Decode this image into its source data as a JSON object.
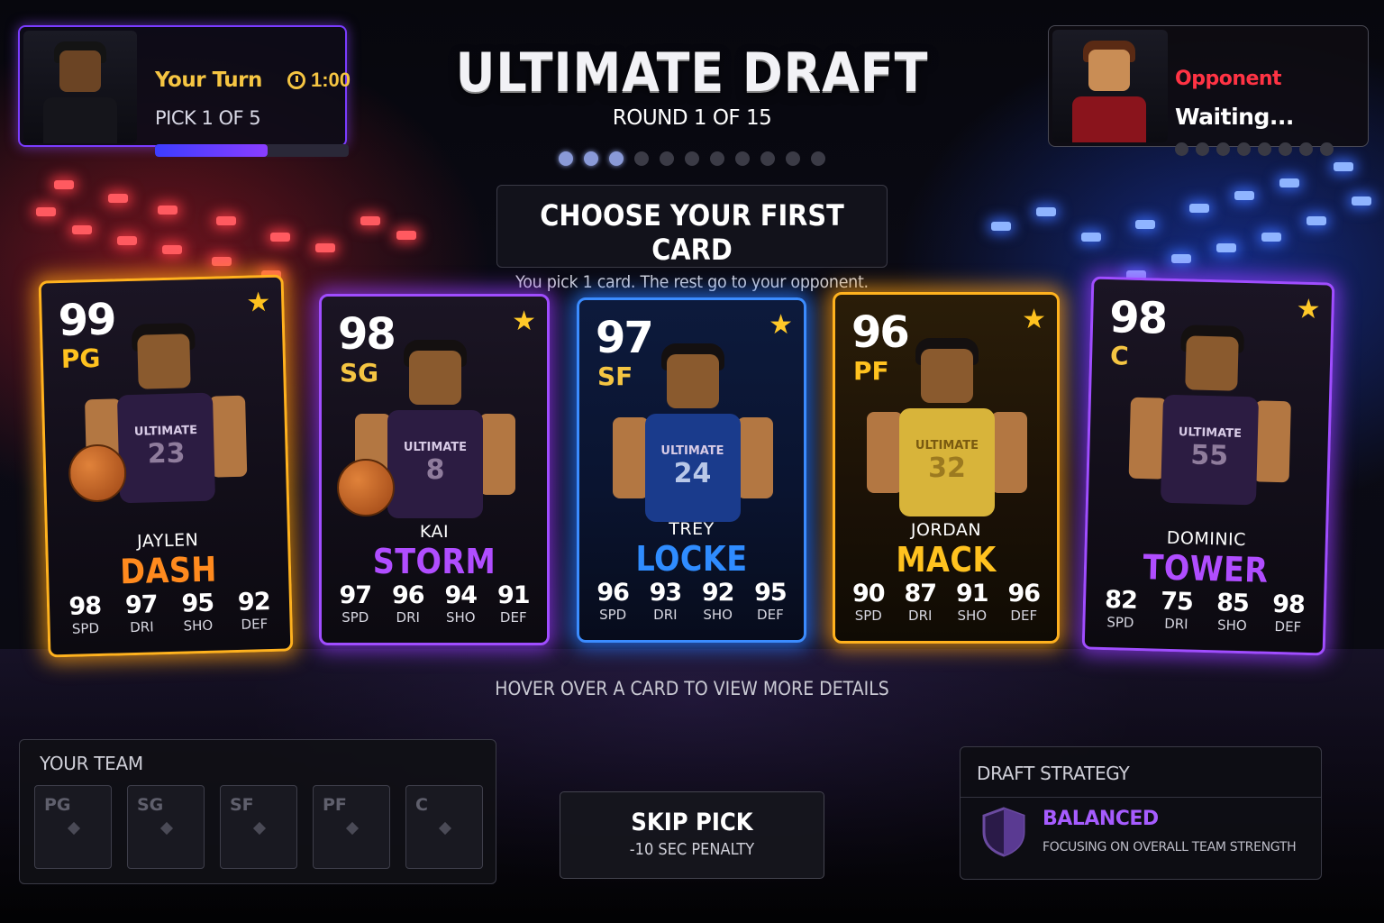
{
  "header": {
    "title": "ULTIMATE DRAFT",
    "round": "ROUND 1 OF 15",
    "round_dots_total": 11,
    "round_dots_active": 3
  },
  "player": {
    "status": "Your Turn",
    "timer": "1:00",
    "pick": "PICK 1 OF 5",
    "progress_percent": 58
  },
  "opponent": {
    "label": "Opponent",
    "status": "Waiting...",
    "dots": 8
  },
  "prompt": {
    "title": "CHOOSE YOUR FIRST CARD",
    "subtitle": "You pick 1 card. The rest go to your opponent."
  },
  "cards": [
    {
      "rating": "99",
      "position": "PG",
      "first_name": "JAYLEN",
      "last_name": "DASH",
      "jersey_team": "ULTIMATE",
      "jersey_number": "23",
      "theme": "gold",
      "name_color": "orange",
      "stats": [
        {
          "value": "98",
          "label": "SPD"
        },
        {
          "value": "97",
          "label": "DRI"
        },
        {
          "value": "95",
          "label": "SHO"
        },
        {
          "value": "92",
          "label": "DEF"
        }
      ]
    },
    {
      "rating": "98",
      "position": "SG",
      "first_name": "KAI",
      "last_name": "STORM",
      "jersey_team": "ULTIMATE",
      "jersey_number": "8",
      "theme": "purple",
      "name_color": "violet",
      "stats": [
        {
          "value": "97",
          "label": "SPD"
        },
        {
          "value": "96",
          "label": "DRI"
        },
        {
          "value": "94",
          "label": "SHO"
        },
        {
          "value": "91",
          "label": "DEF"
        }
      ]
    },
    {
      "rating": "97",
      "position": "SF",
      "first_name": "TREY",
      "last_name": "LOCKE",
      "jersey_team": "ULTIMATE",
      "jersey_number": "24",
      "theme": "blue",
      "name_color": "blue",
      "stats": [
        {
          "value": "96",
          "label": "SPD"
        },
        {
          "value": "93",
          "label": "DRI"
        },
        {
          "value": "92",
          "label": "SHO"
        },
        {
          "value": "95",
          "label": "DEF"
        }
      ]
    },
    {
      "rating": "96",
      "position": "PF",
      "first_name": "JORDAN",
      "last_name": "MACK",
      "jersey_team": "ULTIMATE",
      "jersey_number": "32",
      "theme": "gold",
      "name_color": "yellow",
      "stats": [
        {
          "value": "90",
          "label": "SPD"
        },
        {
          "value": "87",
          "label": "DRI"
        },
        {
          "value": "91",
          "label": "SHO"
        },
        {
          "value": "96",
          "label": "DEF"
        }
      ]
    },
    {
      "rating": "98",
      "position": "C",
      "first_name": "DOMINIC",
      "last_name": "TOWER",
      "jersey_team": "ULTIMATE",
      "jersey_number": "55",
      "theme": "purple",
      "name_color": "violet",
      "stats": [
        {
          "value": "82",
          "label": "SPD"
        },
        {
          "value": "75",
          "label": "DRI"
        },
        {
          "value": "85",
          "label": "SHO"
        },
        {
          "value": "98",
          "label": "DEF"
        }
      ]
    }
  ],
  "hint": "HOVER OVER A CARD TO VIEW MORE DETAILS",
  "team": {
    "title": "YOUR TEAM",
    "slots": [
      "PG",
      "SG",
      "SF",
      "PF",
      "C"
    ]
  },
  "skip": {
    "label": "SKIP PICK",
    "penalty": "-10 SEC PENALTY"
  },
  "strategy": {
    "title": "DRAFT STRATEGY",
    "name": "BALANCED",
    "description": "FOCUSING ON OVERALL TEAM STRENGTH"
  },
  "colors": {
    "gold": "#ffb21e",
    "purple": "#a04dff",
    "blue": "#3b8cff",
    "timer": "#f5c542",
    "opponent": "#ff3344"
  }
}
